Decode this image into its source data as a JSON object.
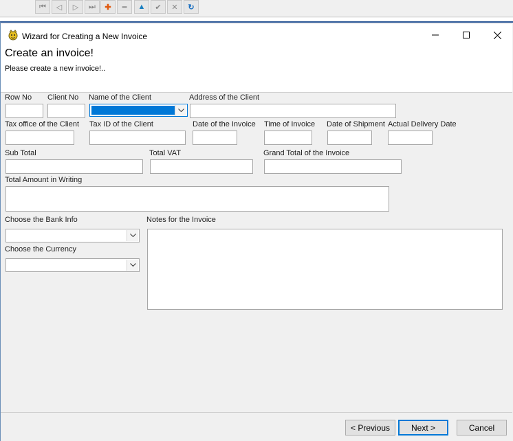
{
  "toolbar": {
    "buttons": [
      {
        "icon": "first-record-icon",
        "glyph": "⏮"
      },
      {
        "icon": "previous-record-icon",
        "glyph": "◁"
      },
      {
        "icon": "next-record-icon",
        "glyph": "▷"
      },
      {
        "icon": "last-record-icon",
        "glyph": "⏭"
      },
      {
        "icon": "add-record-icon",
        "glyph": "✚"
      },
      {
        "icon": "delete-record-icon",
        "glyph": "━"
      },
      {
        "icon": "move-up-icon",
        "glyph": "▲"
      },
      {
        "icon": "confirm-icon",
        "glyph": "✔"
      },
      {
        "icon": "cancel-edit-icon",
        "glyph": "✕"
      },
      {
        "icon": "refresh-icon",
        "glyph": "↻"
      }
    ]
  },
  "window": {
    "title": "Wizard for Creating a New Invoice",
    "minimize_glyph": "—",
    "maximize_glyph": "☐",
    "close_glyph": "✕"
  },
  "header": {
    "title": "Create an invoice!",
    "subtitle": "Please create a new invoice!.."
  },
  "form": {
    "row_no": {
      "label": "Row No",
      "value": ""
    },
    "client_no": {
      "label": "Client No",
      "value": ""
    },
    "client_name": {
      "label": "Name of the Client",
      "value": ""
    },
    "client_address": {
      "label": "Address of the Client",
      "value": ""
    },
    "tax_office": {
      "label": "Tax office of the Client",
      "value": ""
    },
    "tax_id": {
      "label": "Tax ID of the Client",
      "value": ""
    },
    "invoice_date": {
      "label": "Date of the Invoice",
      "value": ""
    },
    "invoice_time": {
      "label": "Time of Invoice",
      "value": ""
    },
    "shipment_date": {
      "label": "Date of Shipment",
      "value": ""
    },
    "delivery_date": {
      "label": "Actual Delivery Date",
      "value": ""
    },
    "sub_total": {
      "label": "Sub Total",
      "value": ""
    },
    "total_vat": {
      "label": "Total VAT",
      "value": ""
    },
    "grand_total": {
      "label": "Grand Total of the Invoice",
      "value": ""
    },
    "amount_in_writing": {
      "label": "Total Amount in Writing",
      "value": ""
    },
    "bank_info": {
      "label": "Choose the Bank Info",
      "value": ""
    },
    "currency": {
      "label": "Choose the Currency",
      "value": ""
    },
    "notes": {
      "label": "Notes for the Invoice",
      "value": ""
    }
  },
  "buttons": {
    "previous": "< Previous",
    "next": "Next >",
    "cancel": "Cancel"
  },
  "colors": {
    "accent": "#0078d7",
    "selection": "#0078d7"
  }
}
